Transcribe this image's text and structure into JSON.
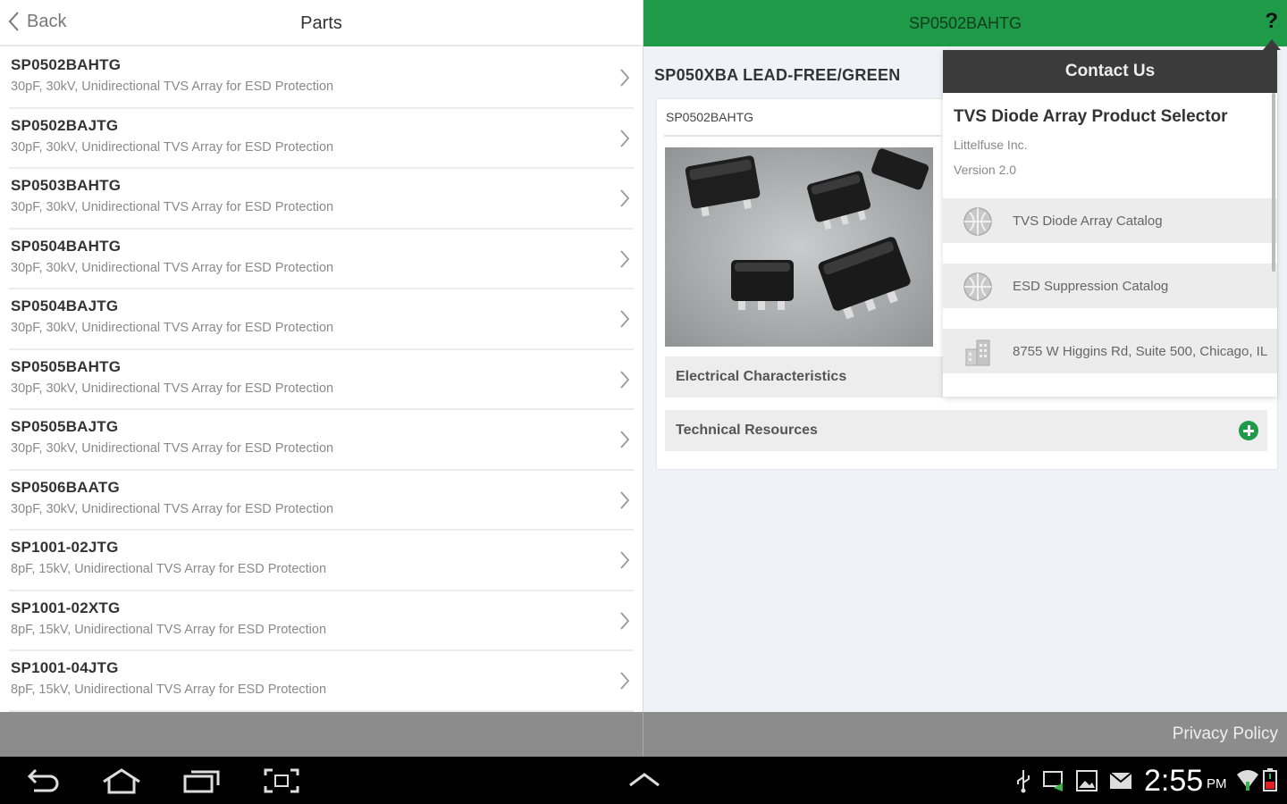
{
  "left": {
    "back_label": "Back",
    "title": "Parts",
    "parts": [
      {
        "name": "SP0502BAHTG",
        "desc": "30pF, 30kV, Unidirectional TVS Array for ESD Protection"
      },
      {
        "name": "SP0502BAJTG",
        "desc": "30pF, 30kV, Unidirectional TVS Array for ESD Protection"
      },
      {
        "name": "SP0503BAHTG",
        "desc": "30pF, 30kV, Unidirectional TVS Array for ESD Protection"
      },
      {
        "name": "SP0504BAHTG",
        "desc": "30pF, 30kV, Unidirectional TVS Array for ESD Protection"
      },
      {
        "name": "SP0504BAJTG",
        "desc": "30pF, 30kV, Unidirectional TVS Array for ESD Protection"
      },
      {
        "name": "SP0505BAHTG",
        "desc": "30pF, 30kV, Unidirectional TVS Array for ESD Protection"
      },
      {
        "name": "SP0505BAJTG",
        "desc": "30pF, 30kV, Unidirectional TVS Array for ESD Protection"
      },
      {
        "name": "SP0506BAATG",
        "desc": "30pF, 30kV, Unidirectional TVS Array for ESD Protection"
      },
      {
        "name": "SP1001-02JTG",
        "desc": "8pF, 15kV, Unidirectional TVS Array for ESD Protection"
      },
      {
        "name": "SP1001-02XTG",
        "desc": "8pF, 15kV, Unidirectional TVS Array for ESD Protection"
      },
      {
        "name": "SP1001-04JTG",
        "desc": "8pF, 15kV, Unidirectional TVS Array for ESD Protection"
      }
    ]
  },
  "right": {
    "header_title": "SP0502BAHTG",
    "help_label": "?",
    "product_heading": "SP050XBA LEAD-FREE/GREEN",
    "card_part_name": "SP0502BAHTG",
    "electrical_label": "Electrical Characteristics",
    "technical_label": "Technical Resources"
  },
  "contact": {
    "header": "Contact Us",
    "app_title": "TVS Diode Array Product Selector",
    "company": "Littelfuse Inc.",
    "version": "Version 2.0",
    "items": [
      {
        "label": "TVS Diode Array Catalog",
        "icon": "globe-icon"
      },
      {
        "label": "ESD Suppression Catalog",
        "icon": "globe-icon"
      },
      {
        "label": "8755 W Higgins Rd, Suite 500, Chicago, IL",
        "icon": "building-icon"
      }
    ]
  },
  "footer": {
    "privacy_label": "Privacy Policy"
  },
  "system": {
    "time": "2:55",
    "ampm": "PM"
  },
  "colors": {
    "brand_green": "#1f9a48",
    "popover_header": "#3b3b3b"
  }
}
